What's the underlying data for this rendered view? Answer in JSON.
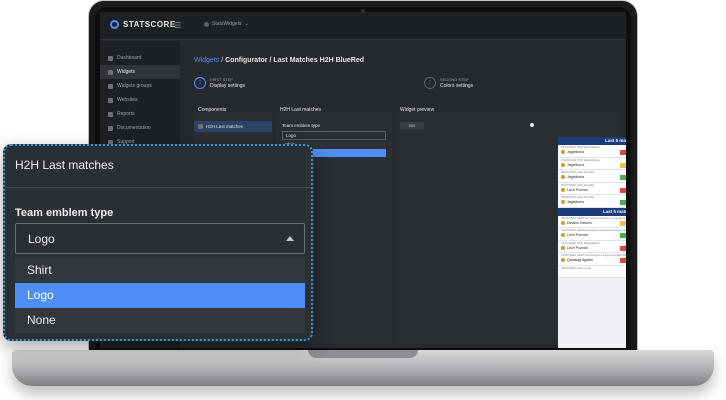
{
  "app": {
    "brand": "STATSCORE",
    "workspace": "StatsWidgets"
  },
  "sidebar": {
    "items": [
      {
        "label": "Dashboard",
        "active": false
      },
      {
        "label": "Widgets",
        "active": true
      },
      {
        "label": "Widgets groups",
        "active": false
      },
      {
        "label": "Websites",
        "active": false
      },
      {
        "label": "Reports",
        "active": false
      },
      {
        "label": "Documentation",
        "active": false
      },
      {
        "label": "Support",
        "active": false
      }
    ]
  },
  "breadcrumb": {
    "root": "Widgets",
    "separator": " / ",
    "path": "Configurator / Last Matches H2H BlueRed"
  },
  "steps": [
    {
      "number": "1",
      "kicker": "FIRST STEP",
      "title": "Display settings"
    },
    {
      "number": "2",
      "kicker": "SECOND STEP",
      "title": "Colors settings"
    }
  ],
  "columns": {
    "components": "Components",
    "h2h": "H2H Last matches",
    "preview": "Widget preview"
  },
  "components": {
    "selected": "H2H Last matches"
  },
  "editor": {
    "field_label": "Team emblem type",
    "value": "Logo",
    "options": [
      "Shirt",
      "Logo",
      "None"
    ]
  },
  "preview": {
    "width_button": "500"
  },
  "widget": {
    "sections": [
      {
        "title": "Last 5 matches - Jagiellonia",
        "matches": [
          {
            "comp": "12/07/2022 PKO Ekstraklasa",
            "home": "Jagiellonia",
            "score": "0 : 2",
            "away": "Widzew Lodz",
            "result": "loss"
          },
          {
            "comp": "16/07/2022 PKO Ekstraklasa",
            "home": "Jagiellonia",
            "score": "1 : 1",
            "away": "Piast Gliwice",
            "result": "draw"
          },
          {
            "comp": "09/07/2022 Club Friendly",
            "home": "Jagiellonia",
            "score": "2 : 1",
            "away": "Chojniczanka",
            "result": "win"
          },
          {
            "comp": "02/07/2022 Club Friendly",
            "home": "Lech Poznan",
            "score": "2 : 1",
            "away": "Jagiellonia",
            "result": "loss"
          },
          {
            "comp": "25/06/2022 Club Friendly",
            "home": "Jagiellonia",
            "score": "2 : 1",
            "away": "Warta Poznan",
            "result": "win"
          }
        ]
      },
      {
        "title": "Last 5 matches - Lech Poznan",
        "matches": [
          {
            "comp": "26/07/2022 UEFA Europa Conference League Qualification",
            "home": "Dinamo Batumi",
            "score": "1 : 1",
            "away": "Lech Poznan",
            "result": "draw"
          },
          {
            "comp": "21/07/2022 UEFA Europa Conference League Qualification",
            "home": "Lech Poznan",
            "score": "5 : 0",
            "away": "Dinamo Batumi",
            "result": "win"
          },
          {
            "comp": "16/07/2022 PKO Ekstraklasa",
            "home": "Lech Poznan",
            "score": "0 : 2",
            "away": "PGE FKS Stal Mielec",
            "result": "loss"
          },
          {
            "comp": "13/07/2022 UEFA Champions League Qualification",
            "home": "Qarabag Agdam",
            "score": "5 : 1",
            "away": "Lech Poznan",
            "result": "loss"
          },
          {
            "comp": "09/07/2022 Super Cup",
            "home": "",
            "score": "",
            "away": "",
            "result": ""
          }
        ]
      }
    ]
  },
  "callout": {
    "title": "H2H Last matches",
    "field_label": "Team emblem type",
    "value": "Logo",
    "options": [
      {
        "label": "Shirt",
        "selected": false
      },
      {
        "label": "Logo",
        "selected": true
      },
      {
        "label": "None",
        "selected": false
      }
    ]
  },
  "colors": {
    "accent": "#4d8ff7",
    "win": "#3fb44b",
    "draw": "#e5c83c",
    "loss": "#e04646",
    "widget_header": "#1d3c79",
    "callout_border": "#2f9bd7"
  }
}
